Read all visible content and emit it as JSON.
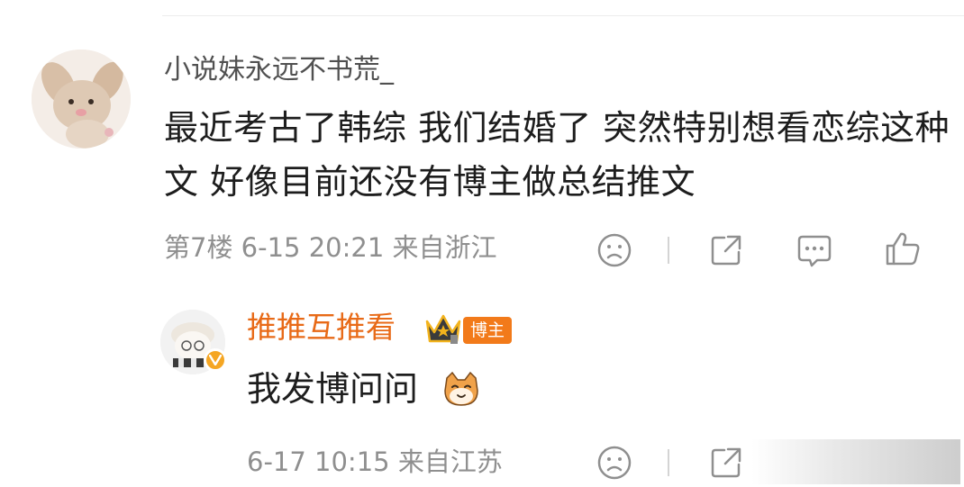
{
  "comment": {
    "username": "小说妹永远不书荒_",
    "text": "最近考古了韩综 我们结婚了 突然特别想看恋综这种文 好像目前还没有博主做总结推文",
    "meta": "第7楼 6-15 20:21 来自浙江",
    "icons": [
      "sad-face-icon",
      "share-icon",
      "comment-icon",
      "like-icon"
    ]
  },
  "reply": {
    "username": "推推互推看",
    "badge_label": "博主",
    "text": "我发博问问",
    "meta": "6-17 10:15 来自江苏",
    "icons": [
      "sad-face-icon",
      "share-icon"
    ]
  },
  "colors": {
    "reply_name": "#e86a17",
    "badge_bg": "#f27a1a",
    "meta_text": "#8f8f8f",
    "body_text": "#1d1d1d"
  }
}
